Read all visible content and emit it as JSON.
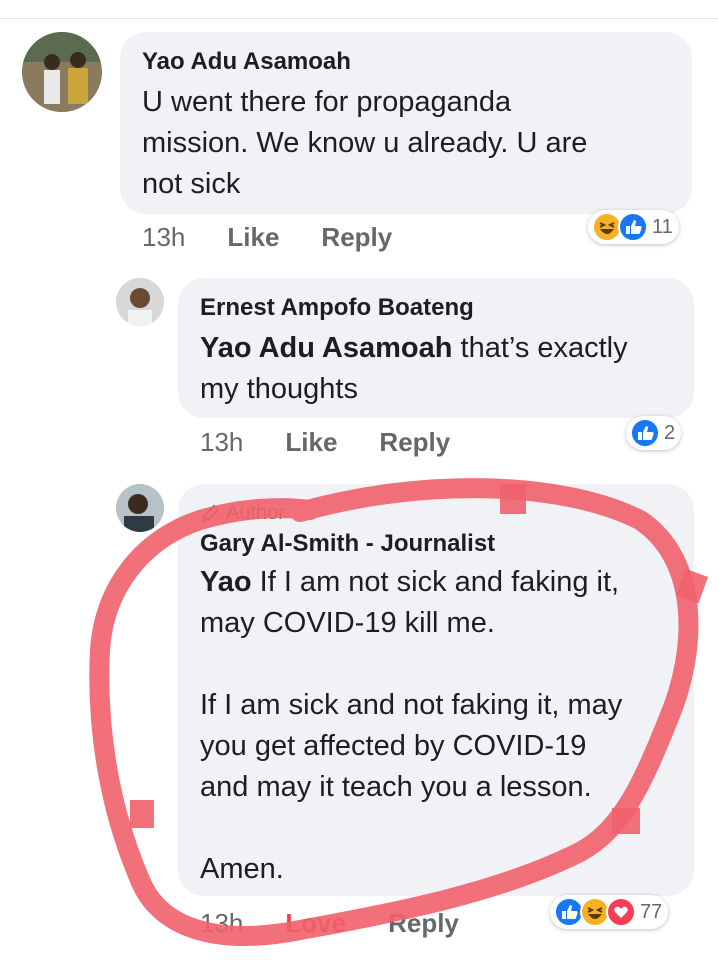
{
  "comments": [
    {
      "name": "Yao Adu Asamoah",
      "lines": [
        "U went there for propaganda",
        "mission. We know u already. U are",
        "not sick"
      ],
      "time": "13h",
      "like": "Like",
      "reply": "Reply",
      "reactions": "11",
      "reaction_icons": [
        "haha-icon",
        "like-icon"
      ]
    },
    {
      "name": "Ernest Ampofo Boateng",
      "mention": "Yao Adu Asamoah",
      "line1_rest": " that’s exactly",
      "line2": "my thoughts",
      "time": "13h",
      "like": "Like",
      "reply": "Reply",
      "reactions": "2",
      "reaction_icons": [
        "like-icon"
      ]
    },
    {
      "badge": "Author",
      "name": "Gary Al-Smith - Journalist",
      "mention": "Yao",
      "line1_rest": " If I am not sick and faking it,",
      "line2": "may COVID-19 kill me.",
      "para2": [
        "If I am sick and not faking it, may",
        "you get affected by COVID-19",
        "and may it teach you a lesson."
      ],
      "para3": "Amen.",
      "time": "13h",
      "like": "Love",
      "reply": "Reply",
      "reactions": "77",
      "reaction_icons": [
        "like-icon",
        "haha-icon",
        "love-icon"
      ]
    }
  ],
  "colors": {
    "like": "#1877f2",
    "love": "#f33e58",
    "haha": "#f7b125",
    "bubble": "#f0f2f5",
    "annotation": "#f0606a"
  }
}
